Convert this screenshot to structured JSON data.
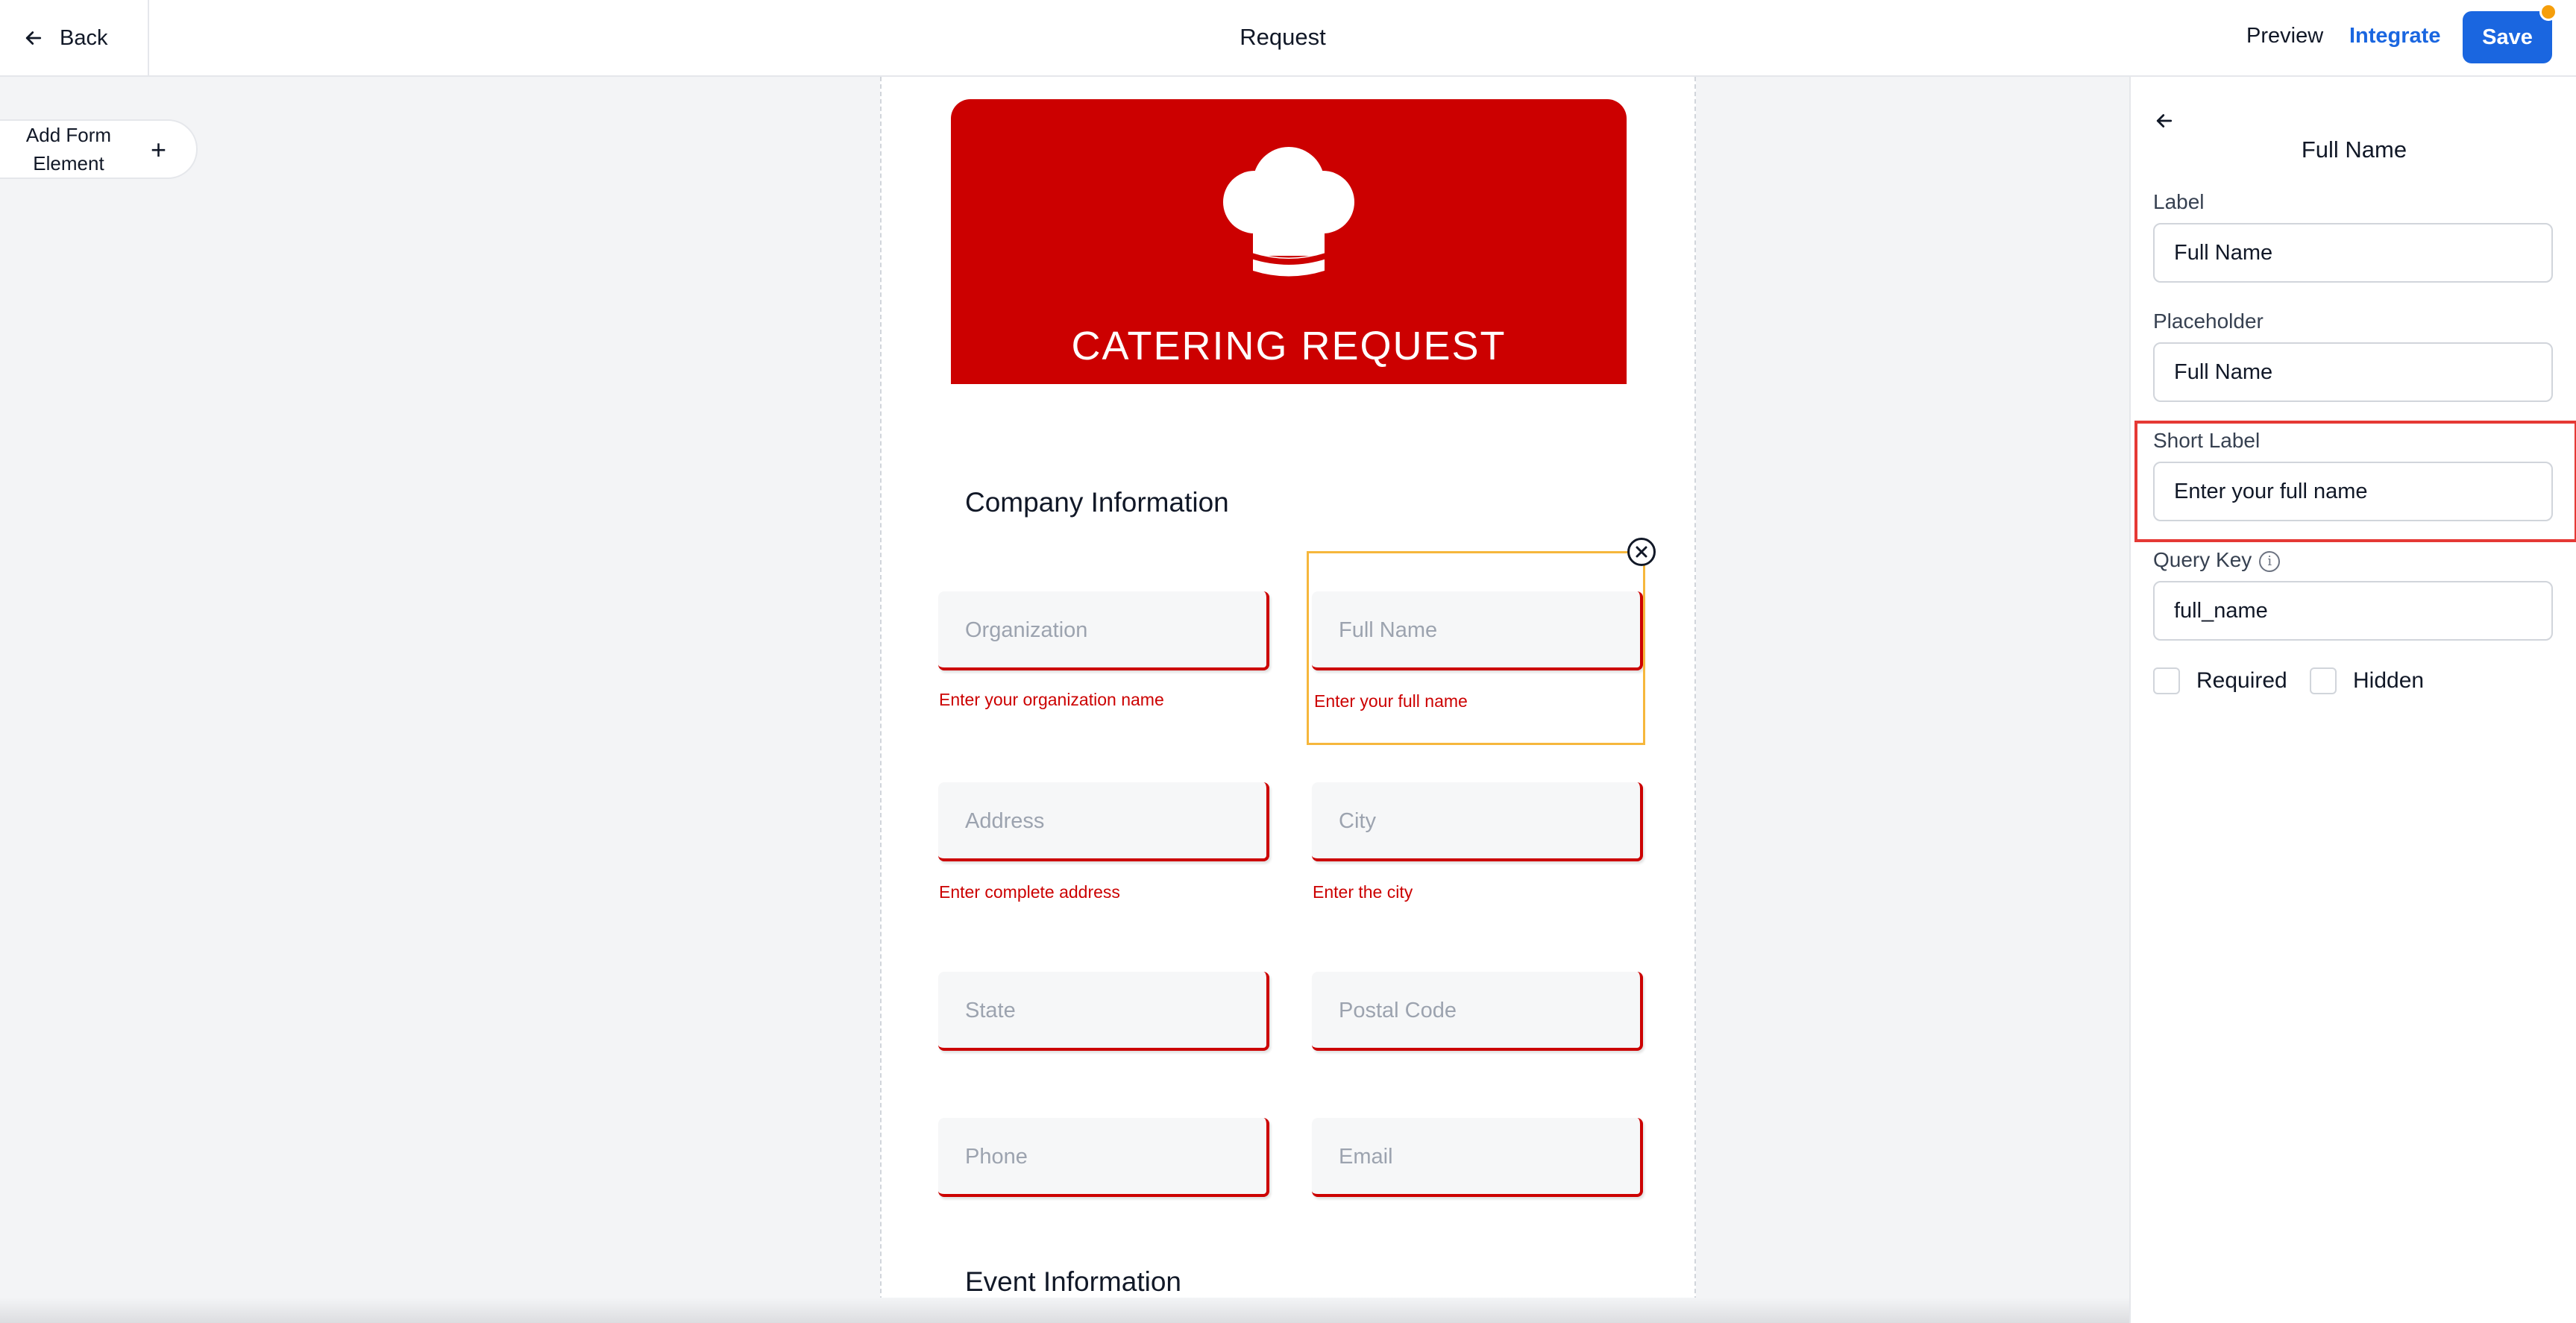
{
  "topbar": {
    "back_label": "Back",
    "title": "Request",
    "preview_label": "Preview",
    "integrate_label": "Integrate",
    "save_label": "Save"
  },
  "sidebar": {
    "add_element_label": "Add Form Element"
  },
  "form": {
    "banner_title": "CATERING REQUEST",
    "company_section": "Company Information",
    "event_section": "Event Information",
    "fields": [
      {
        "placeholder": "Organization",
        "hint": "Enter your organization name"
      },
      {
        "placeholder": "Full Name",
        "hint": "Enter your full name"
      },
      {
        "placeholder": "Address",
        "hint": "Enter complete address"
      },
      {
        "placeholder": "City",
        "hint": "Enter the city"
      },
      {
        "placeholder": "State",
        "hint": ""
      },
      {
        "placeholder": "Postal Code",
        "hint": ""
      },
      {
        "placeholder": "Phone",
        "hint": ""
      },
      {
        "placeholder": "Email",
        "hint": ""
      }
    ]
  },
  "panel": {
    "title": "Full Name",
    "label_caption": "Label",
    "label_value": "Full Name",
    "placeholder_caption": "Placeholder",
    "placeholder_value": "Full Name",
    "short_label_caption": "Short Label",
    "short_label_value": "Enter your full name",
    "query_key_caption": "Query Key",
    "query_key_value": "full_name",
    "required_label": "Required",
    "hidden_label": "Hidden"
  },
  "colors": {
    "accent": "#1a66e0",
    "brand_red": "#cc0000",
    "selection": "#f6b73c",
    "notification": "#f59e0b",
    "highlight": "#e53935"
  }
}
